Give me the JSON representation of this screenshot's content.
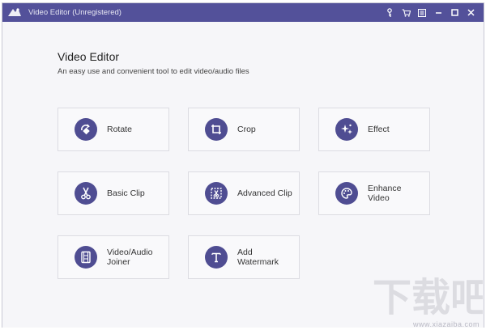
{
  "titlebar": {
    "title": "Video Editor (Unregistered)",
    "controls": [
      "key-icon",
      "cart-icon",
      "menu-icon",
      "minimize-icon",
      "maximize-icon",
      "close-icon"
    ]
  },
  "main": {
    "title": "Video Editor",
    "subtitle": "An easy use and convenient tool to edit video/audio files"
  },
  "tools": [
    {
      "id": "rotate",
      "label": "Rotate",
      "icon": "rotate-icon"
    },
    {
      "id": "crop",
      "label": "Crop",
      "icon": "crop-icon"
    },
    {
      "id": "effect",
      "label": "Effect",
      "icon": "sparkle-icon"
    },
    {
      "id": "basic-clip",
      "label": "Basic Clip",
      "icon": "scissors-icon"
    },
    {
      "id": "advanced-clip",
      "label": "Advanced Clip",
      "icon": "film-scissors-icon"
    },
    {
      "id": "enhance-video",
      "label": "Enhance\nVideo",
      "icon": "palette-icon"
    },
    {
      "id": "joiner",
      "label": "Video/Audio\nJoiner",
      "icon": "film-strip-icon"
    },
    {
      "id": "watermark",
      "label": "Add\nWatermark",
      "icon": "text-t-icon"
    }
  ],
  "watermark": {
    "logo_text": "下载吧",
    "url": "www.xiazaiba.com"
  },
  "colors": {
    "titlebar": "#53519a",
    "icon_circle": "#4f4d92",
    "background": "#f6f6f9"
  }
}
